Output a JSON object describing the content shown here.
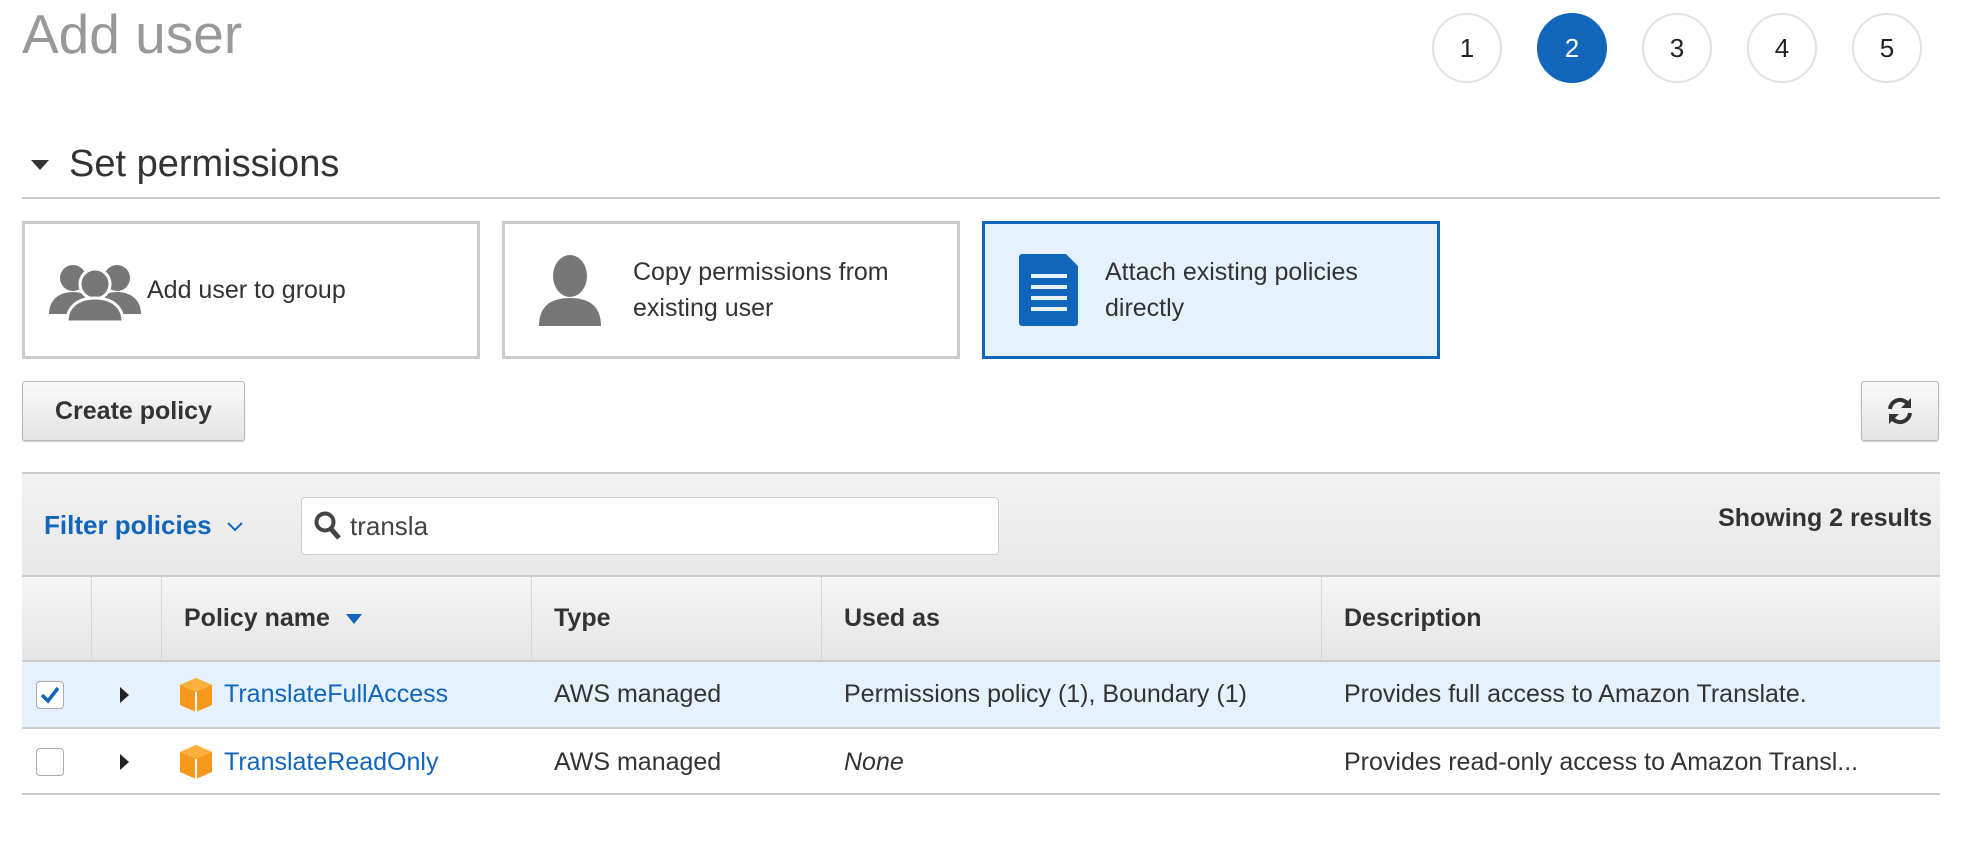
{
  "page": {
    "title": "Add user"
  },
  "steps": [
    {
      "label": "1",
      "active": false
    },
    {
      "label": "2",
      "active": true
    },
    {
      "label": "3",
      "active": false
    },
    {
      "label": "4",
      "active": false
    },
    {
      "label": "5",
      "active": false
    }
  ],
  "section": {
    "title": "Set permissions"
  },
  "options": [
    {
      "label_line1": "Add user to group",
      "label_line2": "",
      "icon": "users-group-icon",
      "selected": false
    },
    {
      "label_line1": "Copy permissions from",
      "label_line2": "existing user",
      "icon": "user-icon",
      "selected": false
    },
    {
      "label_line1": "Attach existing policies",
      "label_line2": "directly",
      "icon": "document-icon",
      "selected": true
    }
  ],
  "toolbar": {
    "create_policy": "Create policy",
    "refresh_icon": "refresh-icon"
  },
  "filter": {
    "label": "Filter policies",
    "search_value": "transla",
    "results": "Showing 2 results"
  },
  "table": {
    "columns": [
      "Policy name",
      "Type",
      "Used as",
      "Description"
    ],
    "sort_column": "Policy name",
    "rows": [
      {
        "checked": true,
        "name": "TranslateFullAccess",
        "type": "AWS managed",
        "used_as": "Permissions policy (1), Boundary (1)",
        "description": "Provides full access to Amazon Translate."
      },
      {
        "checked": false,
        "name": "TranslateReadOnly",
        "type": "AWS managed",
        "used_as": "None",
        "description": "Provides read-only access to Amazon Transl..."
      }
    ]
  },
  "colors": {
    "accent": "#1166bb",
    "selected_bg": "#e5f1fc",
    "policy_icon": "#f7981d"
  }
}
